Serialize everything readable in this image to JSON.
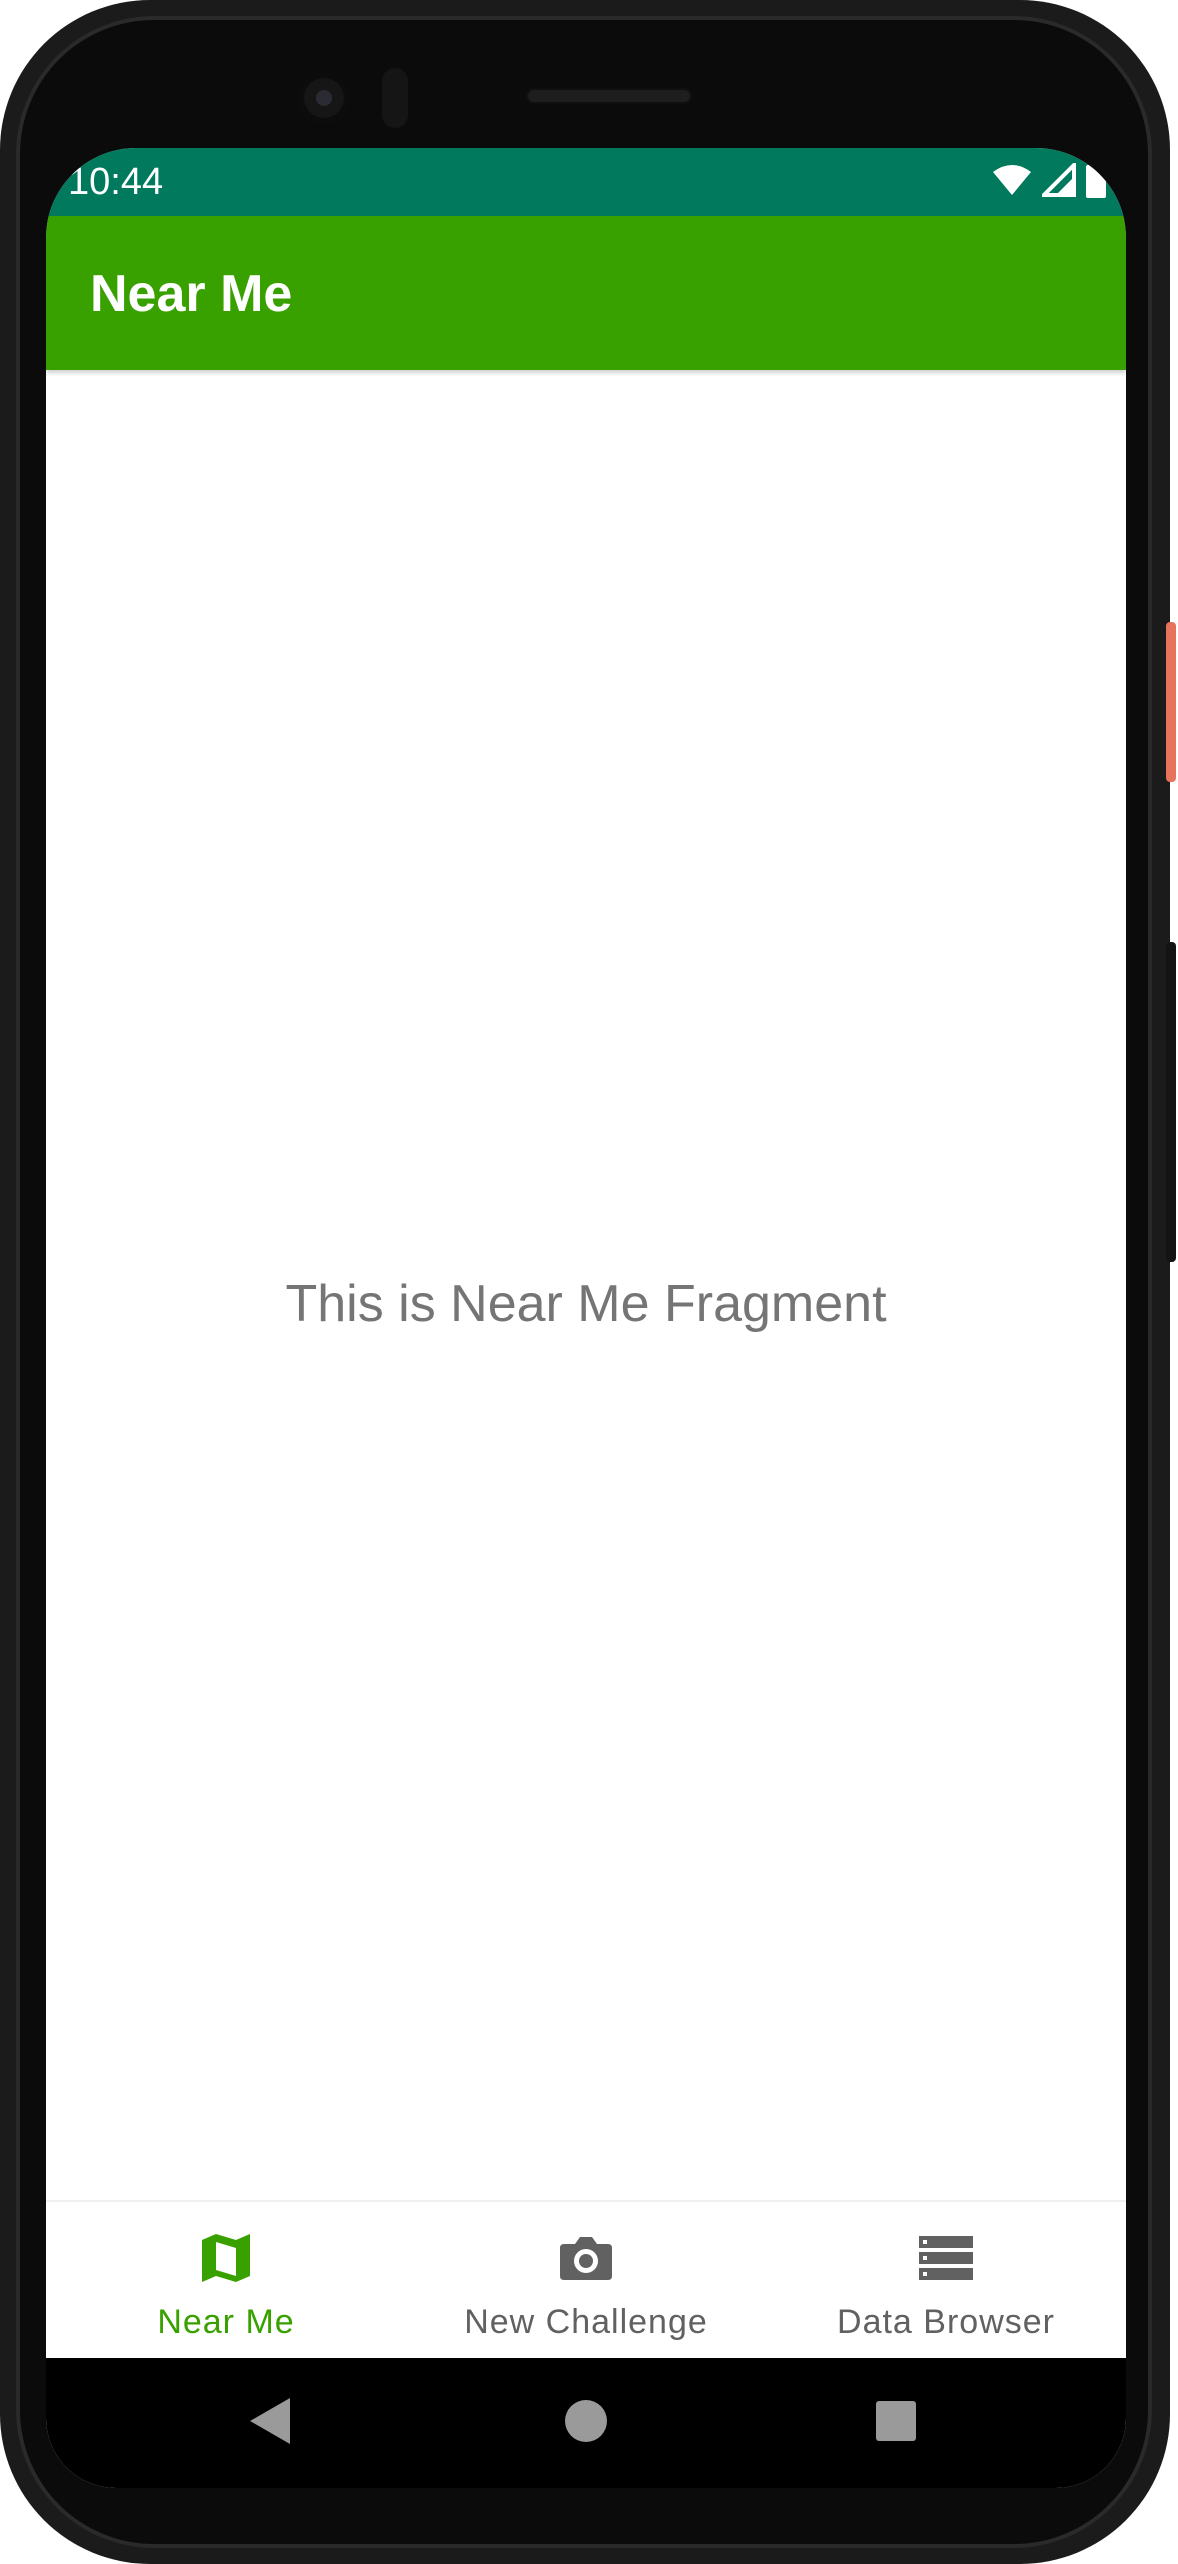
{
  "status_bar": {
    "time": "10:44",
    "icons": [
      "wifi-icon",
      "signal-icon",
      "battery-icon"
    ]
  },
  "app_bar": {
    "title": "Near Me",
    "color": "#38a100"
  },
  "content": {
    "message": "This is Near Me Fragment"
  },
  "bottom_nav": {
    "active_color": "#38a100",
    "inactive_color": "#616161",
    "items": [
      {
        "label": "Near Me",
        "icon": "map-icon",
        "active": true
      },
      {
        "label": "New Challenge",
        "icon": "camera-icon",
        "active": false
      },
      {
        "label": "Data Browser",
        "icon": "storage-icon",
        "active": false
      }
    ]
  },
  "system_nav": {
    "buttons": [
      "back-icon",
      "home-icon",
      "recents-icon"
    ]
  }
}
